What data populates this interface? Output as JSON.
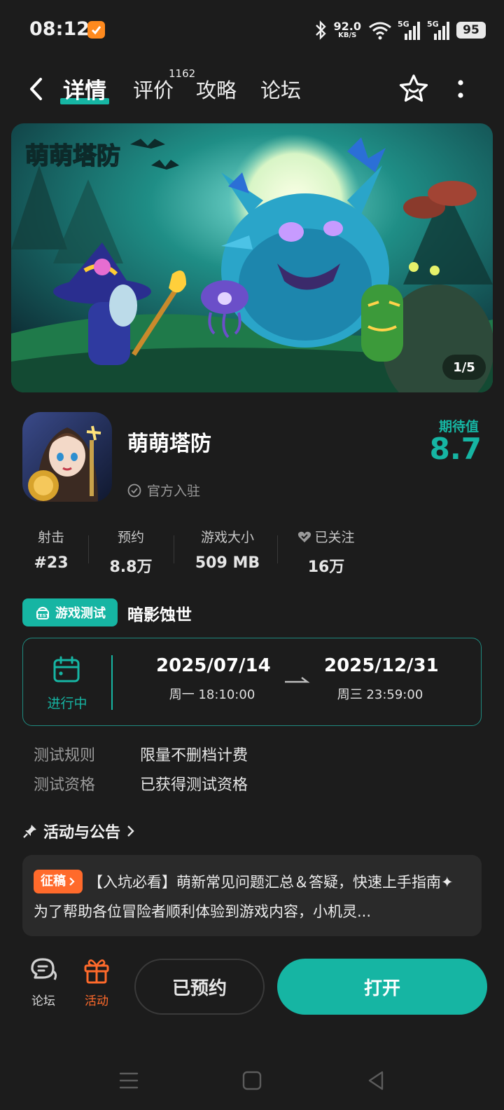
{
  "status_bar": {
    "time": "08:12",
    "net_speed": "92.0",
    "net_unit": "KB/S",
    "sig1": "5G",
    "sig2": "5G",
    "battery": "95"
  },
  "nav": {
    "tabs": [
      "详情",
      "评价",
      "攻略",
      "论坛"
    ],
    "review_count": "1162",
    "active_tab": "详情"
  },
  "banner": {
    "page_indicator": "1/5",
    "logo_text": "萌萌塔防"
  },
  "game": {
    "title": "萌萌塔防",
    "official": "官方入驻",
    "expect_label": "期待值",
    "expect_value": "8.7"
  },
  "stats": [
    {
      "label": "射击",
      "value": "#23"
    },
    {
      "label": "预约",
      "value": "8.8万"
    },
    {
      "label": "游戏大小",
      "value": "509 MB"
    },
    {
      "label": "已关注",
      "value": "16万"
    }
  ],
  "test": {
    "badge": "游戏测试",
    "name": "暗影蚀世",
    "status": "进行中",
    "start_date": "2025/07/14",
    "start_time": "周一  18:10:00",
    "end_date": "2025/12/31",
    "end_time": "周三  23:59:00",
    "rule_label": "测试规则",
    "rule_value": "限量不删档计费",
    "qual_label": "测试资格",
    "qual_value": "已获得测试资格"
  },
  "announcement": {
    "heading": "活动与公告",
    "tag": "征稿",
    "text": "【入坑必看】萌新常见问题汇总＆答疑，快速上手指南✦ 为了帮助各位冒险者顺利体验到游戏内容，小机灵..."
  },
  "bottom_bar": {
    "forum_label": "论坛",
    "activity_label": "活动",
    "reserved_label": "已预约",
    "open_label": "打开"
  },
  "colors": {
    "accent": "#16b5a3",
    "orange": "#ff6a2b",
    "background": "#1c1c1c"
  }
}
